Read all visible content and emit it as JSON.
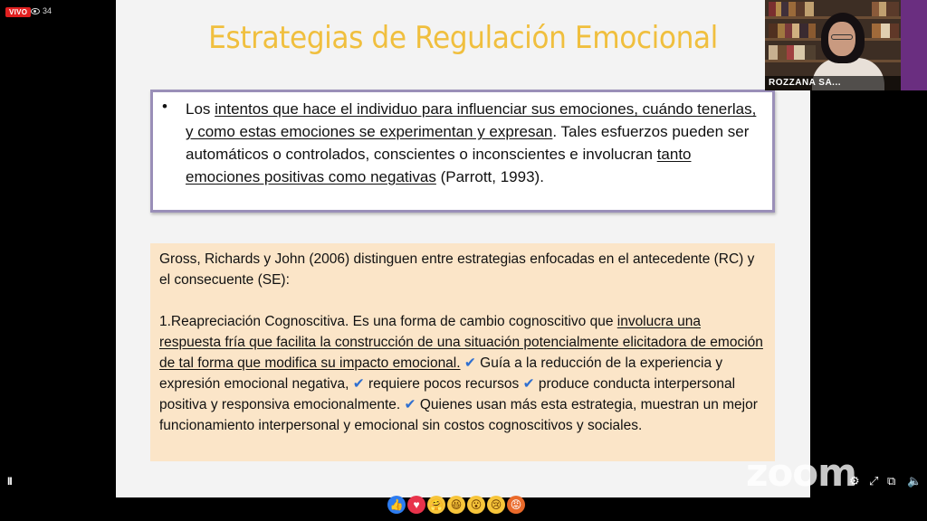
{
  "live": {
    "badge": "VIVO",
    "viewers": "34"
  },
  "slide": {
    "title": "Estrategias de Regulación Emocional",
    "box1": {
      "bullet": "•",
      "seg1": "Los ",
      "seg2_u": "intentos que hace el individuo para influenciar sus emociones, cuándo tenerlas, y como estas emociones se experimentan y expresan",
      "seg3": ". Tales esfuerzos pueden ser automáticos o controlados, conscientes o inconscientes e involucran ",
      "seg4_u": "tanto emociones positivas como negativas",
      "seg5": " (Parrott, 1993)."
    },
    "box2": {
      "intro": "Gross, Richards y John (2006) distinguen entre estrategias enfocadas en el antecedente (RC) y el consecuente (SE):",
      "p_a": "1.Reapreciación Cognoscitiva. Es una forma de cambio cognoscitivo que ",
      "p_u": "involucra una respuesta fría que facilita la construcción de una situación potencialmente elicitadora de emoción de tal forma que modifica su impacto emocional.",
      "check": "✔",
      "p_b": " Guía a la reducción de la experiencia y expresión emocional negativa, ",
      "p_c": " requiere pocos recursos ",
      "p_d": " produce conducta interpersonal positiva y responsiva emocionalmente. ",
      "p_e": " Quienes usan más esta estrategia, muestran un mejor funcionamiento interpersonal y emocional sin costos cognoscitivos y sociales."
    }
  },
  "camera": {
    "name": "ROZZANA SA..."
  },
  "branding": {
    "logo": "zoom"
  },
  "controls": {
    "pause": "II",
    "settings": "⚙",
    "pip": "⧉",
    "expand": "⤢",
    "volume": "🔈"
  },
  "reactions": [
    {
      "name": "like",
      "glyph": "👍"
    },
    {
      "name": "love",
      "glyph": "♥"
    },
    {
      "name": "care",
      "glyph": "🤗"
    },
    {
      "name": "haha",
      "glyph": "😆"
    },
    {
      "name": "wow",
      "glyph": "😮"
    },
    {
      "name": "sad",
      "glyph": "😢"
    },
    {
      "name": "angry",
      "glyph": "😡"
    }
  ]
}
